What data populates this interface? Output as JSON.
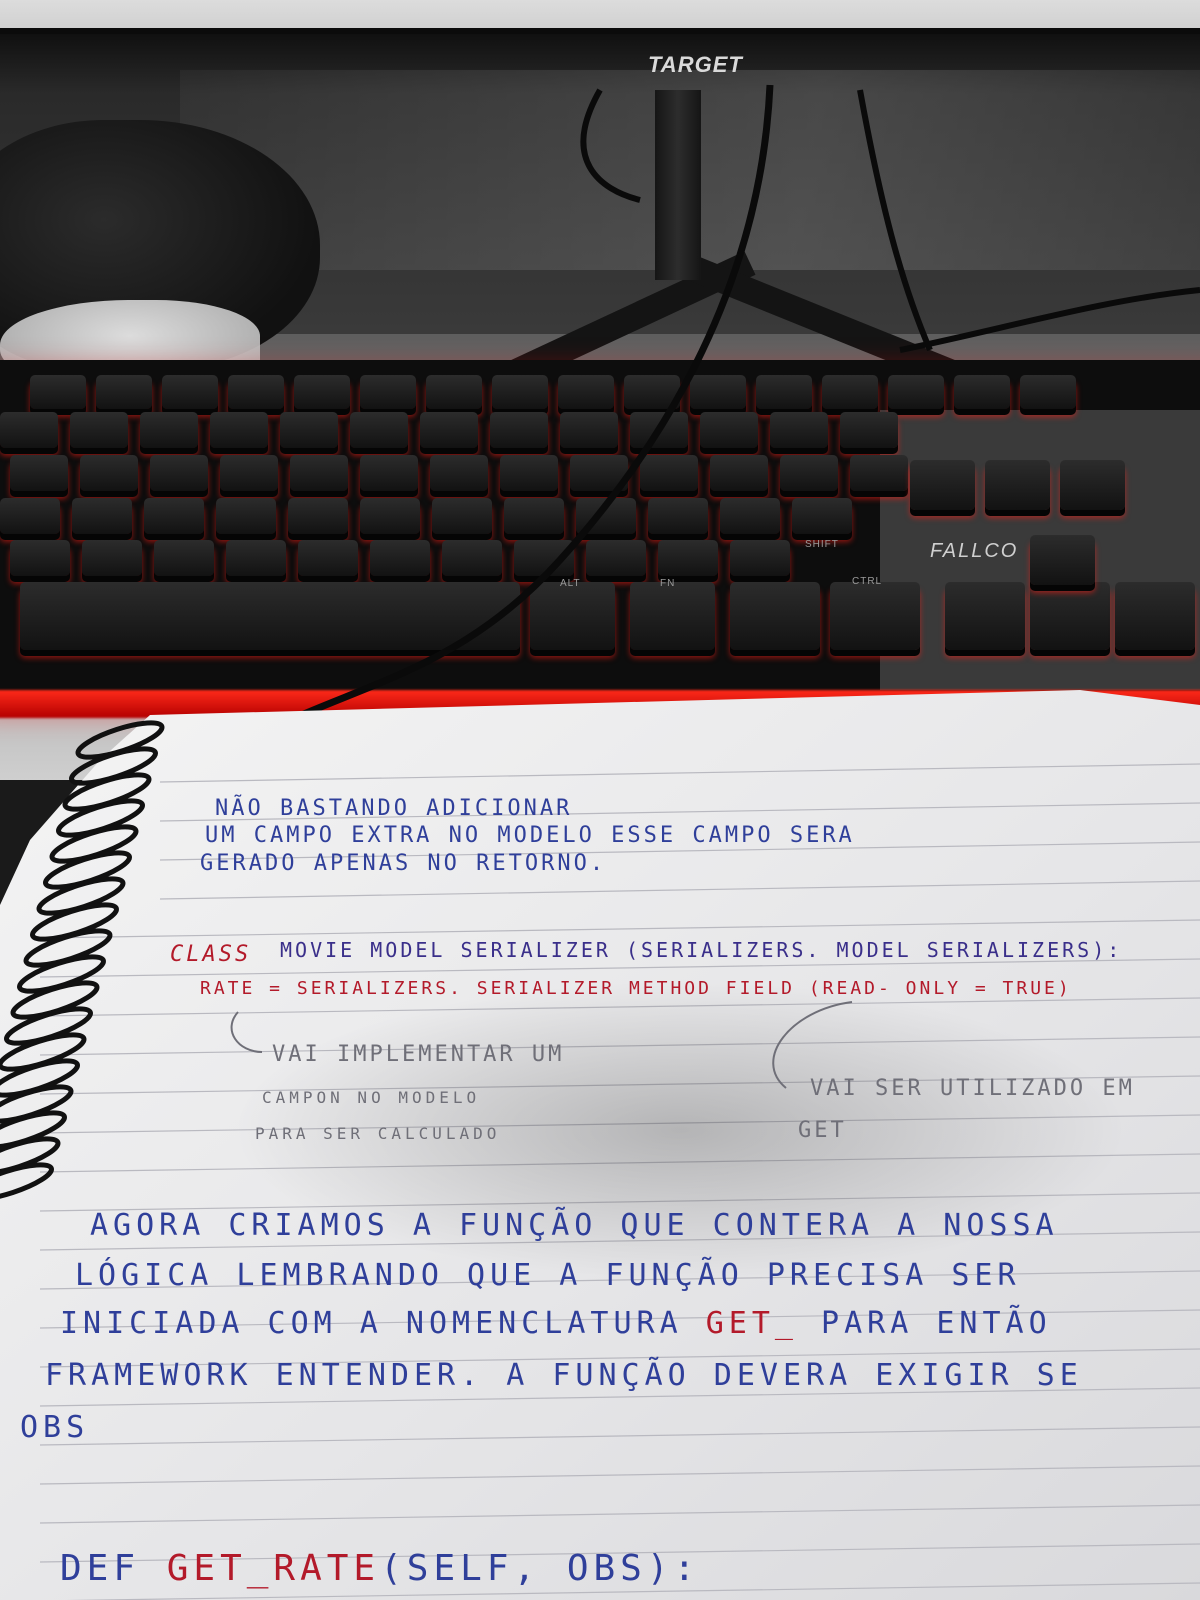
{
  "monitor": {
    "brand": "TARGET"
  },
  "keyboard": {
    "brand": "FALLCO",
    "keys": {
      "shift": "SHIFT",
      "ctrl": "CTRL",
      "alt": "ALT",
      "fn": "FN"
    }
  },
  "notebook": {
    "paragraph1": [
      "NÃO BASTANDO ADICIONAR",
      "UM CAMPO EXTRA NO MODELO ESSE CAMPO SERA",
      "GERADO APENAS NO RETORNO."
    ],
    "code1": {
      "class_keyword": "CLASS",
      "class_line_rest": "MOVIE MODEL SERIALIZER (SERIALIZERS. MODEL SERIALIZERS):",
      "rate_line": "RATE = SERIALIZERS. SERIALIZER METHOD FIELD (READ- ONLY = TRUE)"
    },
    "note_left": [
      "VAI IMPLEMENTAR UM",
      "CAMPON NO MODELO",
      "PARA SER CALCULADO"
    ],
    "note_right": [
      "VAI SER UTILIZADO EM",
      "GET"
    ],
    "paragraph2": [
      [
        "AGORA CRIAMOS A FUNÇÃO QUE CONTERA A NOSSA"
      ],
      [
        "LÓGICA LEMBRANDO QUE A FUNÇÃO PRECISA SER"
      ],
      [
        "INICIADA COM A NOMENCLATURA ",
        "GET_",
        " PARA ENTÃO"
      ],
      [
        "FRAMEWORK ENTENDER. A FUNÇÃO DEVERA EXIGIR SE"
      ],
      [
        "OBS"
      ]
    ],
    "code2": {
      "def": "DEF",
      "name": "GET_RATE",
      "args": "(SELF, OBS):"
    }
  },
  "colors": {
    "ink_blue": "#2f3f9a",
    "ink_red": "#b31a2a",
    "pencil_gray": "#6f6f78",
    "keyboard_glow": "#ff2a1a"
  }
}
